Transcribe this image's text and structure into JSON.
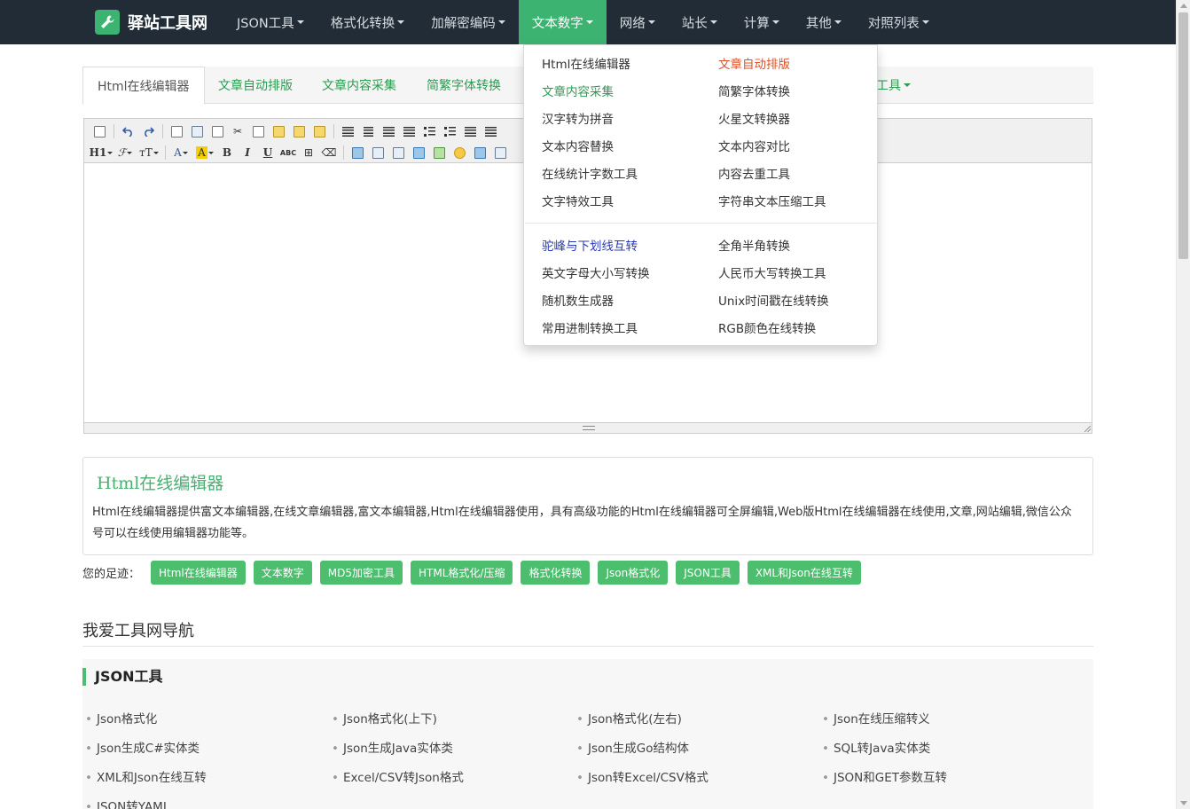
{
  "brand": {
    "name": "驿站工具网",
    "logo_icon": "wrench-icon",
    "logo_color": "#3cb371"
  },
  "nav": [
    {
      "label": "JSON工具"
    },
    {
      "label": "格式化转换"
    },
    {
      "label": "加解密编码"
    },
    {
      "label": "文本数字",
      "active": true
    },
    {
      "label": "网络"
    },
    {
      "label": "站长"
    },
    {
      "label": "计算"
    },
    {
      "label": "其他"
    },
    {
      "label": "对照列表"
    }
  ],
  "tabs": [
    {
      "label": "Html在线编辑器",
      "active": true
    },
    {
      "label": "文章自动排版"
    },
    {
      "label": "文章内容采集"
    },
    {
      "label": "简繁字体转换"
    }
  ],
  "tab_more": "工具",
  "toolbar": {
    "heading_label": "H1",
    "font_label": "ℱ",
    "size_label": "тT",
    "font_color_label": "A",
    "bg_color_label": "A",
    "bold": "B",
    "italic": "I",
    "underline": "U",
    "strike": "ABC"
  },
  "dropdown": {
    "left": [
      {
        "label": "Html在线编辑器"
      },
      {
        "label": "文章内容采集",
        "color": "green"
      },
      {
        "label": "汉字转为拼音"
      },
      {
        "label": "文本内容替换"
      },
      {
        "label": "在线统计字数工具"
      },
      {
        "label": "文字特效工具"
      }
    ],
    "right": [
      {
        "label": "文章自动排版",
        "color": "red"
      },
      {
        "label": "简繁字体转换"
      },
      {
        "label": "火星文转换器"
      },
      {
        "label": "文本内容对比"
      },
      {
        "label": "内容去重工具"
      },
      {
        "label": "字符串文本压缩工具"
      }
    ],
    "left2": [
      {
        "label": "驼峰与下划线互转",
        "color": "blue"
      },
      {
        "label": "英文字母大小写转换"
      },
      {
        "label": "随机数生成器"
      },
      {
        "label": "常用进制转换工具"
      }
    ],
    "right2": [
      {
        "label": "全角半角转换"
      },
      {
        "label": "人民币大写转换工具"
      },
      {
        "label": "Unix时间戳在线转换"
      },
      {
        "label": "RGB颜色在线转换"
      }
    ]
  },
  "description": {
    "title": "Html在线编辑器",
    "text": "Html在线编辑器提供富文本编辑器,在线文章编辑器,富文本编辑器,Html在线编辑器使用，具有高级功能的Html在线编辑器可全屏编辑,Web版Html在线编辑器在线使用,文章,网站编辑,微信公众号可以在线使用编辑器功能等。"
  },
  "footprints": {
    "label": "您的足迹：",
    "tags": [
      "Html在线编辑器",
      "文本数字",
      "MD5加密工具",
      "HTML格式化/压缩",
      "格式化转换",
      "Json格式化",
      "JSON工具",
      "XML和Json在线互转"
    ]
  },
  "site_nav": {
    "heading": "我爱工具网导航",
    "section_title": "JSON工具",
    "links": [
      "Json格式化",
      "Json格式化(上下)",
      "Json格式化(左右)",
      "Json在线压缩转义",
      "Json生成C#实体类",
      "Json生成Java实体类",
      "Json生成Go结构体",
      "SQL转Java实体类",
      "XML和Json在线互转",
      "Excel/CSV转Json格式",
      "Json转Excel/CSV格式",
      "JSON和GET参数互转",
      "JSON转YAML"
    ]
  },
  "colors": {
    "navbar": "#222c37",
    "accent": "#3cb371",
    "tag": "#4cbe6e",
    "link_green": "#2a9d50",
    "link_red": "#d9532b",
    "link_blue": "#2b3bb5"
  }
}
